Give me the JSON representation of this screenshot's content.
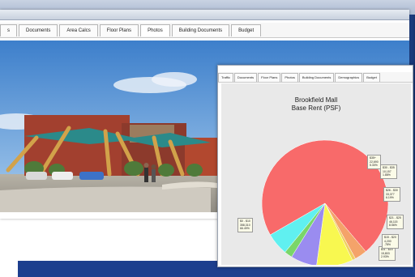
{
  "back_window": {
    "tabs": [
      {
        "label": "s"
      },
      {
        "label": "Documents"
      },
      {
        "label": "Area Calcs"
      },
      {
        "label": "Floor Plans"
      },
      {
        "label": "Photos"
      },
      {
        "label": "Building Documents"
      },
      {
        "label": "Budget"
      }
    ],
    "active_tab": "Photos"
  },
  "front_window": {
    "tabs": [
      {
        "label": "Traffic"
      },
      {
        "label": "Documents"
      },
      {
        "label": "Floor Plans"
      },
      {
        "label": "Photos"
      },
      {
        "label": "Building Documents"
      },
      {
        "label": "Demographics"
      },
      {
        "label": "Budget"
      }
    ]
  },
  "colors": {
    "backdrop_blue": "#1d3f8e",
    "sky": "#5f9fd8",
    "building": "#a2402f"
  },
  "chart_data": {
    "type": "pie",
    "title_line1": "Brookfield Mall",
    "title_line2": "Base Rent (PSF)",
    "slices": [
      {
        "label": "$0 - $10",
        "detail1": "358,310",
        "detail2": "66.49%",
        "value": 66.49,
        "color": "#f86a6a"
      },
      {
        "label": "$11 - $15",
        "detail1": "15,803",
        "detail2": "2.93%",
        "value": 2.93,
        "color": "#f4a36a"
      },
      {
        "label": "$15 - $20",
        "detail1": "4,200",
        "detail2": ".78%",
        "value": 0.78,
        "color": "#f0d060"
      },
      {
        "label": "$21 - $25",
        "detail1": "46,115",
        "detail2": "8.56%",
        "value": 8.56,
        "color": "#f8f850"
      },
      {
        "label": "$26 - $30",
        "detail1": "33,377",
        "detail2": "6.19%",
        "value": 6.19,
        "color": "#9a8cf0"
      },
      {
        "label": "$30 - $35",
        "detail1": "10,157",
        "detail2": "1.88%",
        "value": 1.88,
        "color": "#7ad66a"
      },
      {
        "label": "$35+",
        "detail1": "22,690",
        "detail2": "5.30%",
        "value": 5.3,
        "color": "#60f0f0"
      }
    ]
  }
}
